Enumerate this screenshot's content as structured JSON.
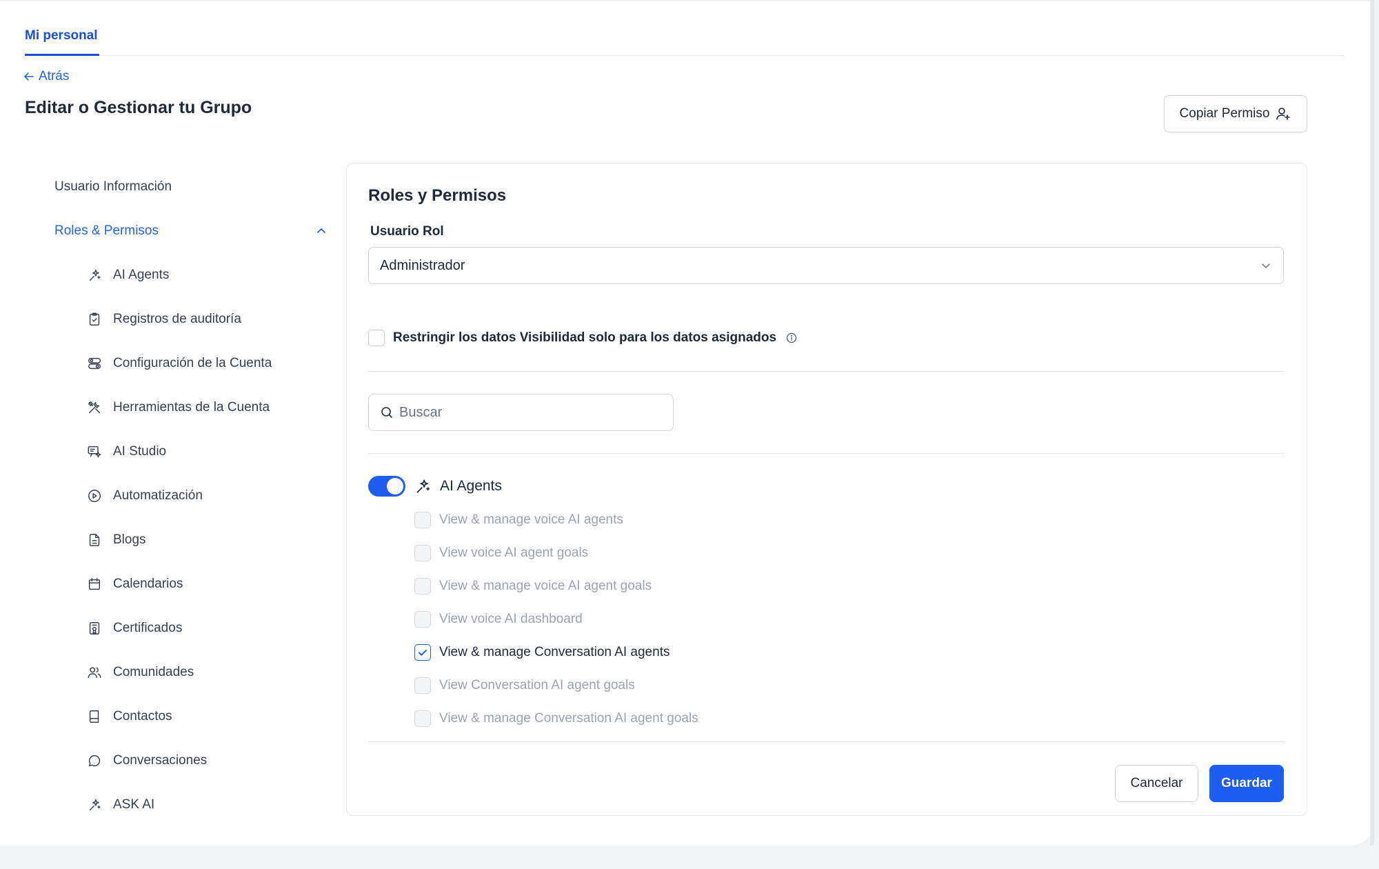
{
  "tabs": [
    {
      "label": "Mi personal",
      "active": true
    }
  ],
  "back_label": "Atrás",
  "page_title": "Editar o Gestionar tu Grupo",
  "copy_permission_label": "Copiar Permiso",
  "sidebar": {
    "user_info": "Usuario Información",
    "roles": "Roles & Permisos",
    "items": [
      {
        "label": "AI Agents",
        "icon": "sparkles-icon"
      },
      {
        "label": "Registros de auditoría",
        "icon": "clipboard-check-icon"
      },
      {
        "label": "Configuración de la Cuenta",
        "icon": "toggles-icon"
      },
      {
        "label": "Herramientas de la Cuenta",
        "icon": "tools-icon"
      },
      {
        "label": "AI Studio",
        "icon": "ai-studio-icon"
      },
      {
        "label": "Automatización",
        "icon": "play-circle-icon"
      },
      {
        "label": "Blogs",
        "icon": "document-icon"
      },
      {
        "label": "Calendarios",
        "icon": "calendar-icon"
      },
      {
        "label": "Certificados",
        "icon": "certificate-icon"
      },
      {
        "label": "Comunidades",
        "icon": "users-icon"
      },
      {
        "label": "Contactos",
        "icon": "book-icon"
      },
      {
        "label": "Conversaciones",
        "icon": "chat-bubble-icon"
      },
      {
        "label": "ASK AI",
        "icon": "sparkles-icon"
      }
    ]
  },
  "card": {
    "title": "Roles y Permisos",
    "role_label": "Usuario Rol",
    "role_value": "Administrador",
    "restrict_label": "Restringir los datos Visibilidad solo para los datos asignados",
    "search_placeholder": "Buscar",
    "section": {
      "label": "AI Agents",
      "enabled": true,
      "permissions": [
        {
          "label": "View & manage voice AI agents",
          "checked": false
        },
        {
          "label": "View voice AI agent goals",
          "checked": false
        },
        {
          "label": "View & manage voice AI agent goals",
          "checked": false
        },
        {
          "label": "View voice AI dashboard",
          "checked": false
        },
        {
          "label": "View & manage Conversation AI agents",
          "checked": true
        },
        {
          "label": "View Conversation AI agent goals",
          "checked": false
        },
        {
          "label": "View & manage Conversation AI agent goals",
          "checked": false
        }
      ]
    },
    "cancel_label": "Cancelar",
    "save_label": "Guardar"
  },
  "colors": {
    "accent": "#1d5ef0",
    "link": "#2563eb",
    "text": "#1f2937"
  }
}
